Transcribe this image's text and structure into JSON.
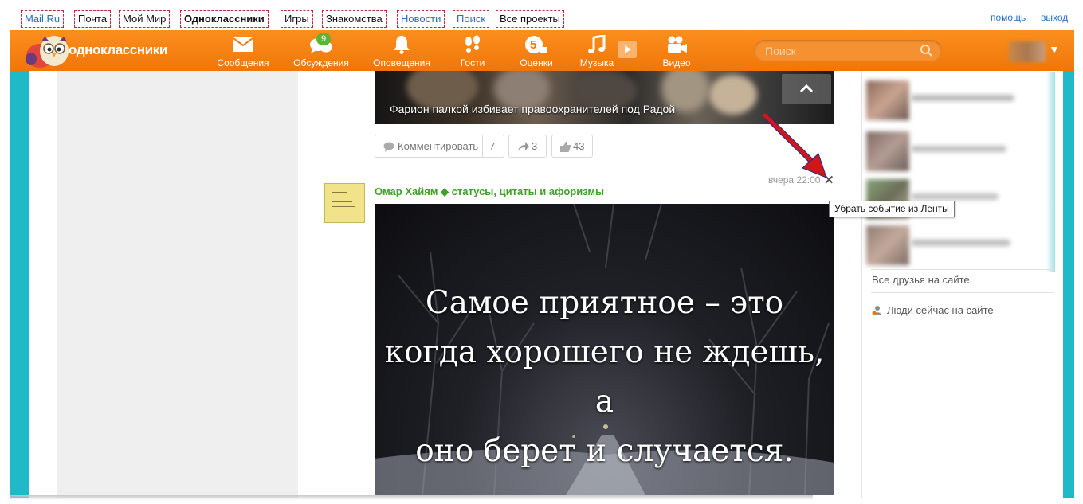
{
  "portal": {
    "links": [
      "Mail.Ru",
      "Почта",
      "Мой Мир",
      "Одноклассники",
      "Игры",
      "Знакомства",
      "Новости",
      "Поиск",
      "Все проекты"
    ],
    "help": "помощь",
    "logout": "выход"
  },
  "toolbar": {
    "logo_text": "одноклассники",
    "nav": [
      "Сообщения",
      "Обсуждения",
      "Оповещения",
      "Гости",
      "Оценки",
      "Музыка",
      "Видео"
    ],
    "discussions_badge": "9",
    "search_placeholder": "Поиск"
  },
  "feed": {
    "video_caption": "Фарион палкой избивает правоохранителей под Радой",
    "comment_label": "Комментировать",
    "comment_count": "7",
    "share_count": "3",
    "like_count": "43",
    "post": {
      "author": "Омар Хайям ◆ статусы, цитаты и афоризмы",
      "time": "вчера 22:00",
      "close_glyph": "✕",
      "quote_lines": [
        "Самое приятное – это",
        "когда хорошего не ждешь, а",
        "оно берет и случается."
      ]
    }
  },
  "tooltip": "Убрать событие из Ленты",
  "sidebar": {
    "all_friends": "Все друзья на сайте",
    "online_now": "Люди сейчас на сайте"
  },
  "colors": {
    "toolbar_orange": "#f58220",
    "teal": "#1fb9c7",
    "author_green": "#3fa12a",
    "link_blue": "#2a6ebc",
    "arrow_red": "#d0161b"
  }
}
